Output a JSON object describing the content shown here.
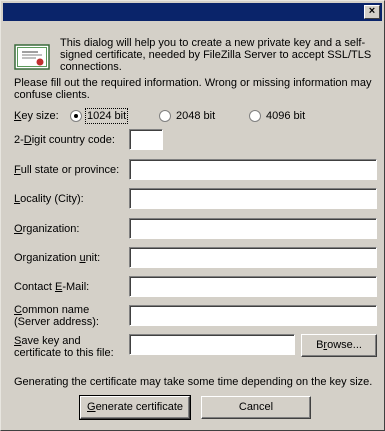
{
  "window": {
    "title": "",
    "close_glyph": "×"
  },
  "intro": {
    "text": "This dialog will help you to create a new private key and a self-signed certificate, needed by FileZilla Server to accept SSL/TLS connections.",
    "required": "Please fill out the required information. Wrong or missing information may confuse clients."
  },
  "key_size": {
    "label_ul": "K",
    "label_rest": "ey size:",
    "options": [
      {
        "label": "1024 bit",
        "selected": true
      },
      {
        "label": "2048 bit",
        "selected": false
      },
      {
        "label": "4096 bit",
        "selected": false
      }
    ]
  },
  "fields": {
    "country": {
      "pre": "2-",
      "ul": "D",
      "post": "igit country code:",
      "value": ""
    },
    "state": {
      "pre": "",
      "ul": "F",
      "post": "ull state or province:",
      "value": ""
    },
    "locality": {
      "pre": "",
      "ul": "L",
      "post": "ocality (City):",
      "value": ""
    },
    "organization": {
      "pre": "",
      "ul": "O",
      "post": "rganization:",
      "value": ""
    },
    "org_unit": {
      "pre": "Organization ",
      "ul": "u",
      "post": "nit:",
      "value": ""
    },
    "email": {
      "pre": "Contact ",
      "ul": "E",
      "post": "-Mail:",
      "value": ""
    },
    "common_name": {
      "pre": "",
      "ul": "C",
      "post": "ommon name",
      "line2": "(Server address):",
      "value": ""
    },
    "save": {
      "pre": "",
      "ul": "S",
      "post": "ave key and",
      "line2": "certificate to this file:",
      "value": ""
    }
  },
  "buttons": {
    "browse_pre": "B",
    "browse_ul": "r",
    "browse_post": "owse...",
    "generate_pre": "",
    "generate_ul": "G",
    "generate_post": "enerate certificate",
    "cancel": "Cancel"
  },
  "note": "Generating the certificate may take some time depending on the key size."
}
